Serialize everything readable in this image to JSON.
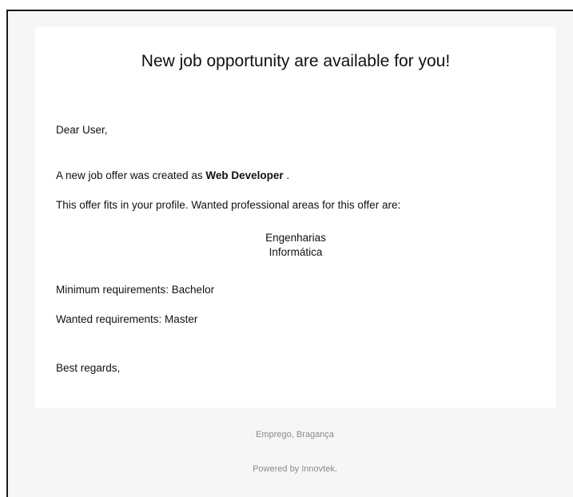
{
  "email": {
    "heading": "New job opportunity are available for you!",
    "greeting": "Dear User,",
    "offer_prefix": "A new job offer was created as ",
    "offer_title": "Web Developer",
    "offer_suffix": " .",
    "profile_text": "This offer fits in your profile. Wanted professional areas for this offer are:",
    "areas": [
      "Engenharias",
      "Informática"
    ],
    "minimum_requirements": "Minimum requirements: Bachelor",
    "wanted_requirements": "Wanted requirements: Master",
    "closing": "Best regards,"
  },
  "footer": {
    "location": "Emprego, Bragança",
    "powered_by": "Powered by Innovtek."
  }
}
